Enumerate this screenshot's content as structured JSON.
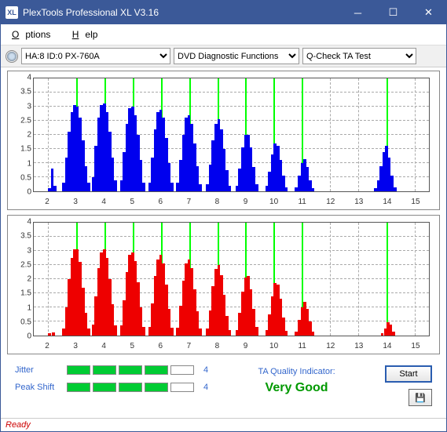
{
  "window": {
    "title": "PlexTools Professional XL V3.16",
    "icon_text": "XL"
  },
  "menu": {
    "options": "Options",
    "help": "Help"
  },
  "toolbar": {
    "drive": "HA:8 ID:0   PX-760A",
    "func": "DVD Diagnostic Functions",
    "test": "Q-Check TA Test"
  },
  "chart_data": [
    {
      "type": "bar",
      "color": "#0000ee",
      "xlim": [
        1.5,
        15.5
      ],
      "ylim": [
        0,
        4
      ],
      "xticks": [
        2,
        3,
        4,
        5,
        6,
        7,
        8,
        9,
        10,
        11,
        12,
        13,
        14,
        15
      ],
      "yticks": [
        0,
        0.5,
        1,
        1.5,
        2,
        2.5,
        3,
        3.5,
        4
      ],
      "markers": [
        3,
        4,
        5,
        6,
        7,
        8,
        9,
        10,
        11,
        14
      ],
      "series": [
        {
          "x": 2.05,
          "y": 0.1
        },
        {
          "x": 2.15,
          "y": 0.8
        },
        {
          "x": 2.25,
          "y": 0.2
        },
        {
          "x": 2.55,
          "y": 0.3
        },
        {
          "x": 2.65,
          "y": 1.2
        },
        {
          "x": 2.75,
          "y": 2.1
        },
        {
          "x": 2.85,
          "y": 2.8
        },
        {
          "x": 2.95,
          "y": 3.05
        },
        {
          "x": 3.05,
          "y": 3.0
        },
        {
          "x": 3.15,
          "y": 2.6
        },
        {
          "x": 3.25,
          "y": 1.8
        },
        {
          "x": 3.35,
          "y": 0.9
        },
        {
          "x": 3.45,
          "y": 0.3
        },
        {
          "x": 3.6,
          "y": 0.5
        },
        {
          "x": 3.7,
          "y": 1.6
        },
        {
          "x": 3.8,
          "y": 2.6
        },
        {
          "x": 3.9,
          "y": 3.05
        },
        {
          "x": 4.0,
          "y": 3.1
        },
        {
          "x": 4.1,
          "y": 2.8
        },
        {
          "x": 4.2,
          "y": 2.1
        },
        {
          "x": 4.3,
          "y": 1.2
        },
        {
          "x": 4.4,
          "y": 0.4
        },
        {
          "x": 4.6,
          "y": 0.4
        },
        {
          "x": 4.7,
          "y": 1.4
        },
        {
          "x": 4.8,
          "y": 2.4
        },
        {
          "x": 4.9,
          "y": 2.95
        },
        {
          "x": 5.0,
          "y": 3.0
        },
        {
          "x": 5.1,
          "y": 2.7
        },
        {
          "x": 5.2,
          "y": 2.0
        },
        {
          "x": 5.3,
          "y": 1.1
        },
        {
          "x": 5.4,
          "y": 0.3
        },
        {
          "x": 5.6,
          "y": 0.3
        },
        {
          "x": 5.7,
          "y": 1.2
        },
        {
          "x": 5.8,
          "y": 2.2
        },
        {
          "x": 5.9,
          "y": 2.8
        },
        {
          "x": 6.0,
          "y": 2.9
        },
        {
          "x": 6.1,
          "y": 2.6
        },
        {
          "x": 6.2,
          "y": 1.9
        },
        {
          "x": 6.3,
          "y": 1.0
        },
        {
          "x": 6.4,
          "y": 0.3
        },
        {
          "x": 6.6,
          "y": 0.3
        },
        {
          "x": 6.7,
          "y": 1.1
        },
        {
          "x": 6.8,
          "y": 2.0
        },
        {
          "x": 6.9,
          "y": 2.6
        },
        {
          "x": 7.0,
          "y": 2.7
        },
        {
          "x": 7.1,
          "y": 2.4
        },
        {
          "x": 7.2,
          "y": 1.7
        },
        {
          "x": 7.3,
          "y": 0.9
        },
        {
          "x": 7.4,
          "y": 0.25
        },
        {
          "x": 7.65,
          "y": 0.25
        },
        {
          "x": 7.75,
          "y": 0.95
        },
        {
          "x": 7.85,
          "y": 1.8
        },
        {
          "x": 7.95,
          "y": 2.4
        },
        {
          "x": 8.05,
          "y": 2.55
        },
        {
          "x": 8.15,
          "y": 2.2
        },
        {
          "x": 8.25,
          "y": 1.5
        },
        {
          "x": 8.35,
          "y": 0.75
        },
        {
          "x": 8.45,
          "y": 0.2
        },
        {
          "x": 8.7,
          "y": 0.2
        },
        {
          "x": 8.8,
          "y": 0.8
        },
        {
          "x": 8.9,
          "y": 1.55
        },
        {
          "x": 9.0,
          "y": 2.0
        },
        {
          "x": 9.1,
          "y": 2.0
        },
        {
          "x": 9.2,
          "y": 1.55
        },
        {
          "x": 9.3,
          "y": 0.85
        },
        {
          "x": 9.4,
          "y": 0.25
        },
        {
          "x": 9.75,
          "y": 0.2
        },
        {
          "x": 9.85,
          "y": 0.7
        },
        {
          "x": 9.95,
          "y": 1.3
        },
        {
          "x": 10.05,
          "y": 1.7
        },
        {
          "x": 10.15,
          "y": 1.6
        },
        {
          "x": 10.25,
          "y": 1.1
        },
        {
          "x": 10.35,
          "y": 0.55
        },
        {
          "x": 10.45,
          "y": 0.15
        },
        {
          "x": 10.8,
          "y": 0.15
        },
        {
          "x": 10.9,
          "y": 0.55
        },
        {
          "x": 11.0,
          "y": 1.0
        },
        {
          "x": 11.1,
          "y": 1.15
        },
        {
          "x": 11.2,
          "y": 0.85
        },
        {
          "x": 11.3,
          "y": 0.4
        },
        {
          "x": 11.4,
          "y": 0.1
        },
        {
          "x": 13.6,
          "y": 0.1
        },
        {
          "x": 13.7,
          "y": 0.4
        },
        {
          "x": 13.8,
          "y": 0.9
        },
        {
          "x": 13.9,
          "y": 1.4
        },
        {
          "x": 14.0,
          "y": 1.6
        },
        {
          "x": 14.1,
          "y": 1.2
        },
        {
          "x": 14.2,
          "y": 0.55
        },
        {
          "x": 14.3,
          "y": 0.15
        }
      ]
    },
    {
      "type": "bar",
      "color": "#ee0000",
      "xlim": [
        1.5,
        15.5
      ],
      "ylim": [
        0,
        4
      ],
      "xticks": [
        2,
        3,
        4,
        5,
        6,
        7,
        8,
        9,
        10,
        11,
        12,
        13,
        14,
        15
      ],
      "yticks": [
        0,
        0.5,
        1,
        1.5,
        2,
        2.5,
        3,
        3.5,
        4
      ],
      "markers": [
        3,
        4,
        5,
        6,
        7,
        8,
        9,
        10,
        11,
        14
      ],
      "series": [
        {
          "x": 2.05,
          "y": 0.08
        },
        {
          "x": 2.2,
          "y": 0.1
        },
        {
          "x": 2.55,
          "y": 0.25
        },
        {
          "x": 2.65,
          "y": 1.0
        },
        {
          "x": 2.75,
          "y": 2.0
        },
        {
          "x": 2.85,
          "y": 2.75
        },
        {
          "x": 2.95,
          "y": 3.05
        },
        {
          "x": 3.05,
          "y": 3.05
        },
        {
          "x": 3.15,
          "y": 2.6
        },
        {
          "x": 3.25,
          "y": 1.7
        },
        {
          "x": 3.35,
          "y": 0.8
        },
        {
          "x": 3.45,
          "y": 0.25
        },
        {
          "x": 3.6,
          "y": 0.4
        },
        {
          "x": 3.7,
          "y": 1.4
        },
        {
          "x": 3.8,
          "y": 2.4
        },
        {
          "x": 3.9,
          "y": 2.95
        },
        {
          "x": 4.0,
          "y": 3.05
        },
        {
          "x": 4.1,
          "y": 2.75
        },
        {
          "x": 4.2,
          "y": 2.0
        },
        {
          "x": 4.3,
          "y": 1.1
        },
        {
          "x": 4.4,
          "y": 0.35
        },
        {
          "x": 4.6,
          "y": 0.35
        },
        {
          "x": 4.7,
          "y": 1.25
        },
        {
          "x": 4.8,
          "y": 2.25
        },
        {
          "x": 4.9,
          "y": 2.85
        },
        {
          "x": 5.0,
          "y": 2.95
        },
        {
          "x": 5.1,
          "y": 2.65
        },
        {
          "x": 5.2,
          "y": 1.9
        },
        {
          "x": 5.3,
          "y": 1.0
        },
        {
          "x": 5.4,
          "y": 0.3
        },
        {
          "x": 5.6,
          "y": 0.3
        },
        {
          "x": 5.7,
          "y": 1.15
        },
        {
          "x": 5.8,
          "y": 2.1
        },
        {
          "x": 5.9,
          "y": 2.7
        },
        {
          "x": 6.0,
          "y": 2.85
        },
        {
          "x": 6.1,
          "y": 2.55
        },
        {
          "x": 6.2,
          "y": 1.8
        },
        {
          "x": 6.3,
          "y": 0.95
        },
        {
          "x": 6.4,
          "y": 0.28
        },
        {
          "x": 6.6,
          "y": 0.28
        },
        {
          "x": 6.7,
          "y": 1.05
        },
        {
          "x": 6.8,
          "y": 1.95
        },
        {
          "x": 6.9,
          "y": 2.55
        },
        {
          "x": 7.0,
          "y": 2.7
        },
        {
          "x": 7.1,
          "y": 2.4
        },
        {
          "x": 7.2,
          "y": 1.65
        },
        {
          "x": 7.3,
          "y": 0.85
        },
        {
          "x": 7.4,
          "y": 0.25
        },
        {
          "x": 7.65,
          "y": 0.25
        },
        {
          "x": 7.75,
          "y": 0.9
        },
        {
          "x": 7.85,
          "y": 1.75
        },
        {
          "x": 7.95,
          "y": 2.35
        },
        {
          "x": 8.05,
          "y": 2.5
        },
        {
          "x": 8.15,
          "y": 2.15
        },
        {
          "x": 8.25,
          "y": 1.45
        },
        {
          "x": 8.35,
          "y": 0.7
        },
        {
          "x": 8.45,
          "y": 0.2
        },
        {
          "x": 8.7,
          "y": 0.2
        },
        {
          "x": 8.8,
          "y": 0.8
        },
        {
          "x": 8.9,
          "y": 1.55
        },
        {
          "x": 9.0,
          "y": 2.05
        },
        {
          "x": 9.1,
          "y": 2.1
        },
        {
          "x": 9.2,
          "y": 1.65
        },
        {
          "x": 9.3,
          "y": 0.95
        },
        {
          "x": 9.4,
          "y": 0.3
        },
        {
          "x": 9.75,
          "y": 0.2
        },
        {
          "x": 9.85,
          "y": 0.75
        },
        {
          "x": 9.95,
          "y": 1.4
        },
        {
          "x": 10.05,
          "y": 1.85
        },
        {
          "x": 10.15,
          "y": 1.8
        },
        {
          "x": 10.25,
          "y": 1.3
        },
        {
          "x": 10.35,
          "y": 0.65
        },
        {
          "x": 10.45,
          "y": 0.18
        },
        {
          "x": 10.8,
          "y": 0.15
        },
        {
          "x": 10.9,
          "y": 0.55
        },
        {
          "x": 11.0,
          "y": 1.0
        },
        {
          "x": 11.1,
          "y": 1.2
        },
        {
          "x": 11.2,
          "y": 0.95
        },
        {
          "x": 11.3,
          "y": 0.5
        },
        {
          "x": 11.4,
          "y": 0.15
        },
        {
          "x": 13.85,
          "y": 0.08
        },
        {
          "x": 13.95,
          "y": 0.25
        },
        {
          "x": 14.05,
          "y": 0.48
        },
        {
          "x": 14.15,
          "y": 0.4
        },
        {
          "x": 14.25,
          "y": 0.15
        }
      ]
    }
  ],
  "metrics": {
    "jitter_label": "Jitter",
    "jitter_bars": [
      true,
      true,
      true,
      true,
      false
    ],
    "jitter_value": "4",
    "peak_label": "Peak Shift",
    "peak_bars": [
      true,
      true,
      true,
      true,
      false
    ],
    "peak_value": "4"
  },
  "quality": {
    "label": "TA Quality Indicator:",
    "value": "Very Good"
  },
  "actions": {
    "start": "Start"
  },
  "status": "Ready"
}
